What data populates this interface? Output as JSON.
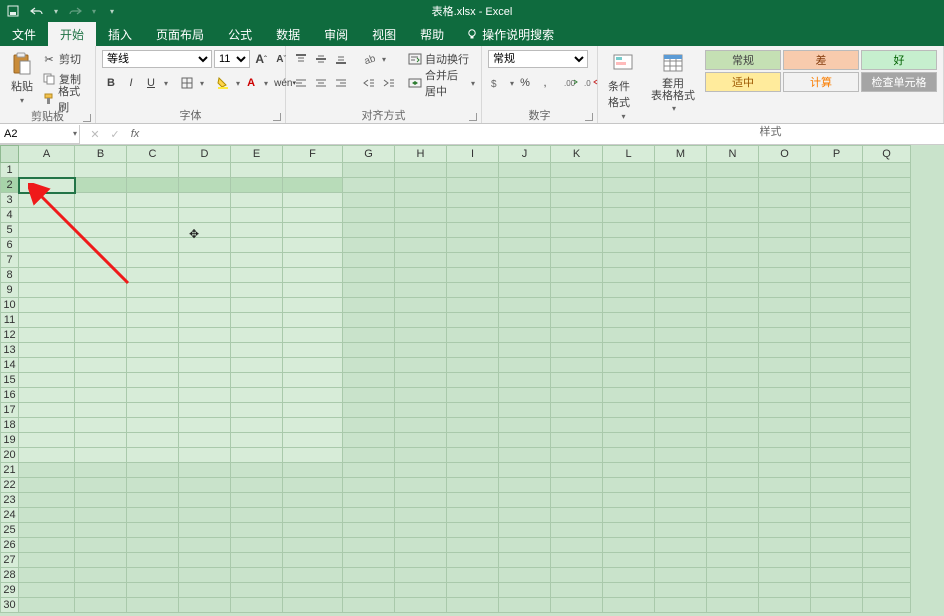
{
  "title": "表格.xlsx  -  Excel",
  "qat": {
    "save": "保存",
    "undo": "撤销",
    "redo": "重做"
  },
  "tabs": [
    "文件",
    "开始",
    "插入",
    "页面布局",
    "公式",
    "数据",
    "审阅",
    "视图",
    "帮助"
  ],
  "tellme": "操作说明搜索",
  "clipboard": {
    "paste": "粘贴",
    "cut": "剪切",
    "copy": "复制",
    "painter": "格式刷",
    "label": "剪贴板"
  },
  "font": {
    "name": "等线",
    "size": "11",
    "grow": "A",
    "shrink": "A",
    "bold": "B",
    "italic": "I",
    "underline": "U",
    "label": "字体"
  },
  "align": {
    "wrap": "自动换行",
    "merge": "合并后居中",
    "label": "对齐方式"
  },
  "number": {
    "format": "常规",
    "label": "数字"
  },
  "styles": {
    "cond": "条件格式",
    "tbl": "套用\n表格格式",
    "cells": [
      "常规",
      "差",
      "好",
      "适中",
      "计算",
      "检查单元格"
    ],
    "label": "样式"
  },
  "namebox": "A2",
  "columns": [
    "A",
    "B",
    "C",
    "D",
    "E",
    "F",
    "G",
    "H",
    "I",
    "J",
    "K",
    "L",
    "M",
    "N",
    "O",
    "P",
    "Q"
  ],
  "rows": 30,
  "activeCell": {
    "row": 2,
    "col": "A"
  },
  "selection": {
    "row": 2,
    "cols": [
      "A",
      "B",
      "C",
      "D",
      "E",
      "F"
    ]
  },
  "bgRegion": {
    "rows": [
      1,
      2,
      3,
      4,
      5,
      6,
      7,
      8,
      9,
      10,
      11,
      12,
      13,
      14,
      15,
      16,
      17,
      18,
      19,
      20
    ],
    "cols": [
      "A",
      "B",
      "C",
      "D",
      "E",
      "F"
    ]
  }
}
